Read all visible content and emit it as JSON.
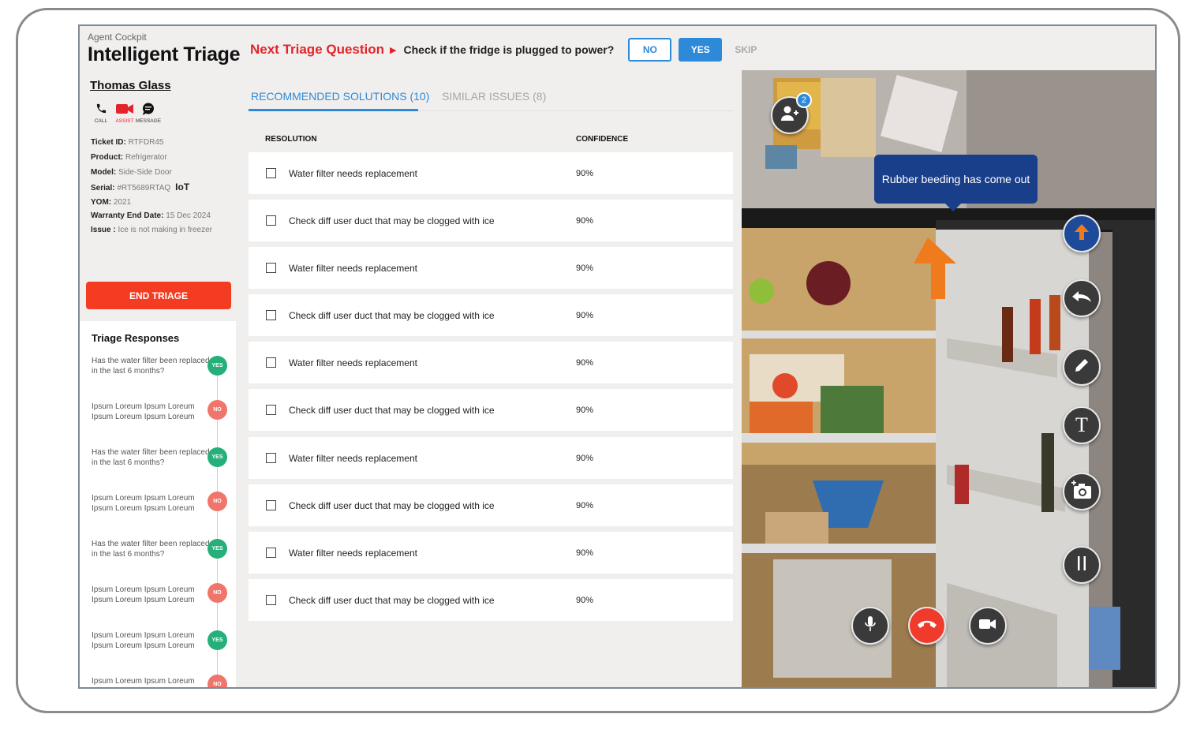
{
  "brand": {
    "subtitle": "Agent Cockpit",
    "title": "Intelligent Triage"
  },
  "triage_question": {
    "label": "Next Triage Question",
    "question": "Check if the fridge is plugged to power?",
    "no": "NO",
    "yes": "YES",
    "skip": "SKIP"
  },
  "customer": {
    "name": "Thomas Glass"
  },
  "actions": [
    {
      "label": "CALL",
      "icon": "phone-icon"
    },
    {
      "label": "ASSIST",
      "icon": "video-camera-icon",
      "active": true
    },
    {
      "label": "MESSAGE",
      "icon": "chat-bubble-icon"
    }
  ],
  "ticket": {
    "ticket_id_label": "Ticket ID:",
    "ticket_id": "RTFDR45",
    "product_label": "Product:",
    "product": "Refrigerator",
    "model_label": "Model:",
    "model": "Side-Side Door",
    "serial_label": "Serial:",
    "serial": "#RT5689RTAQ",
    "iot": "IoT",
    "yom_label": "YOM:",
    "yom": "2021",
    "warranty_label": "Warranty End Date:",
    "warranty": "15 Dec 2024",
    "issue_label": "Issue :",
    "issue": "Ice is not making in freezer"
  },
  "end_triage": "END TRIAGE",
  "triage_responses": {
    "title": "Triage Responses",
    "items": [
      {
        "text": "Has the water filter been replaced in the last 6 months?",
        "answer": "YES"
      },
      {
        "text": "Ipsum Loreum Ipsum Loreum Ipsum Loreum Ipsum Loreum",
        "answer": "NO"
      },
      {
        "text": "Has the water filter been replaced in the last 6 months?",
        "answer": "YES"
      },
      {
        "text": "Ipsum Loreum Ipsum Loreum Ipsum Loreum Ipsum Loreum",
        "answer": "NO"
      },
      {
        "text": "Has the water filter been replaced in the last 6 months?",
        "answer": "YES"
      },
      {
        "text": "Ipsum Loreum Ipsum Loreum Ipsum Loreum Ipsum Loreum",
        "answer": "NO"
      },
      {
        "text": "Ipsum Loreum Ipsum Loreum Ipsum Loreum Ipsum Loreum",
        "answer": "YES"
      },
      {
        "text": "Ipsum Loreum Ipsum Loreum Ipsum Loreum Ipsum Loreum",
        "answer": "NO"
      }
    ]
  },
  "tabs": {
    "recommended": "RECOMMENDED SOLUTIONS (10)",
    "similar": "SIMILAR ISSUES (8)"
  },
  "table": {
    "col_resolution": "RESOLUTION",
    "col_confidence": "CONFIDENCE",
    "rows": [
      {
        "resolution": "Water filter needs replacement",
        "confidence": "90%"
      },
      {
        "resolution": "Check diff user duct that may be clogged with ice",
        "confidence": "90%"
      },
      {
        "resolution": "Water filter needs replacement",
        "confidence": "90%"
      },
      {
        "resolution": "Check diff user duct that may be clogged with ice",
        "confidence": "90%"
      },
      {
        "resolution": "Water filter needs replacement",
        "confidence": "90%"
      },
      {
        "resolution": "Check diff user duct that may be clogged with ice",
        "confidence": "90%"
      },
      {
        "resolution": "Water filter needs replacement",
        "confidence": "90%"
      },
      {
        "resolution": "Check diff user duct that may be clogged with ice",
        "confidence": "90%"
      },
      {
        "resolution": "Water filter needs replacement",
        "confidence": "90%"
      },
      {
        "resolution": "Check diff user duct that may be clogged with ice",
        "confidence": "90%"
      }
    ]
  },
  "video": {
    "participants_count": "2",
    "annotation": "Rubber beeding has come out",
    "tools": [
      "arrow-up-icon",
      "undo-icon",
      "pencil-icon",
      "text-icon",
      "add-photo-icon",
      "pause-icon"
    ],
    "call_controls": [
      "microphone-icon",
      "end-call-icon",
      "video-icon"
    ],
    "text_tool_glyph": "T"
  },
  "colors": {
    "accent": "#2d8ad8",
    "danger": "#f43c23",
    "title_red": "#e3242b",
    "yes": "#25b07a",
    "no": "#f0756b",
    "callout": "#1a3f8a",
    "arrow": "#f07b1d"
  }
}
